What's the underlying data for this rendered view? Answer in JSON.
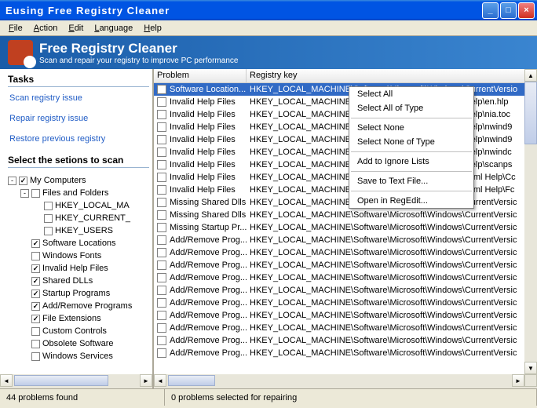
{
  "window": {
    "title": "Eusing Free Registry Cleaner"
  },
  "menu": [
    "File",
    "Action",
    "Edit",
    "Language",
    "Help"
  ],
  "banner": {
    "title": "Free Registry Cleaner",
    "sub": "Scan and repair your registry to improve PC performance"
  },
  "tasks": {
    "header": "Tasks",
    "items": [
      "Scan registry issue",
      "Repair registry issue",
      "Restore previous registry"
    ]
  },
  "sections": {
    "header": "Select the setions to scan",
    "tree": [
      {
        "indent": 0,
        "exp": "-",
        "checked": true,
        "label": "My Computers"
      },
      {
        "indent": 1,
        "exp": "-",
        "checked": false,
        "label": "Files and Folders"
      },
      {
        "indent": 2,
        "exp": "",
        "checked": false,
        "label": "HKEY_LOCAL_MA"
      },
      {
        "indent": 2,
        "exp": "",
        "checked": false,
        "label": "HKEY_CURRENT_"
      },
      {
        "indent": 2,
        "exp": "",
        "checked": false,
        "label": "HKEY_USERS"
      },
      {
        "indent": 1,
        "exp": "",
        "checked": true,
        "label": "Software Locations"
      },
      {
        "indent": 1,
        "exp": "",
        "checked": false,
        "label": "Windows Fonts"
      },
      {
        "indent": 1,
        "exp": "",
        "checked": true,
        "label": "Invalid Help Files"
      },
      {
        "indent": 1,
        "exp": "",
        "checked": true,
        "label": "Shared DLLs"
      },
      {
        "indent": 1,
        "exp": "",
        "checked": true,
        "label": "Startup Programs"
      },
      {
        "indent": 1,
        "exp": "",
        "checked": true,
        "label": "Add/Remove Programs"
      },
      {
        "indent": 1,
        "exp": "",
        "checked": true,
        "label": "File Extensions"
      },
      {
        "indent": 1,
        "exp": "",
        "checked": false,
        "label": "Custom Controls"
      },
      {
        "indent": 1,
        "exp": "",
        "checked": false,
        "label": "Obsolete Software"
      },
      {
        "indent": 1,
        "exp": "",
        "checked": false,
        "label": "Windows Services"
      }
    ]
  },
  "list": {
    "col1": "Problem",
    "col2": "Registry key",
    "rows": [
      {
        "sel": true,
        "problem": "Software Location...",
        "key": "HKEY_LOCAL_MACHINE\\Software\\Microsoft\\Windows\\CurrentVersio"
      },
      {
        "problem": "Invalid Help Files",
        "key": "HKEY_LOCAL_MACHINE\\Software\\Microsoft\\Windows\\Help\\en.hlp"
      },
      {
        "problem": "Invalid Help Files",
        "key": "HKEY_LOCAL_MACHINE\\Software\\Microsoft\\Windows\\Help\\nia.toc"
      },
      {
        "problem": "Invalid Help Files",
        "key": "HKEY_LOCAL_MACHINE\\Software\\Microsoft\\Windows\\Help\\nwind9"
      },
      {
        "problem": "Invalid Help Files",
        "key": "HKEY_LOCAL_MACHINE\\Software\\Microsoft\\Windows\\Help\\nwind9"
      },
      {
        "problem": "Invalid Help Files",
        "key": "HKEY_LOCAL_MACHINE\\Software\\Microsoft\\Windows\\Help\\nwindc"
      },
      {
        "problem": "Invalid Help Files",
        "key": "HKEY_LOCAL_MACHINE\\Software\\Microsoft\\Windows\\Help\\scanps"
      },
      {
        "problem": "Invalid Help Files",
        "key": "HKEY_LOCAL_MACHINE\\Software\\Microsoft\\Windows\\Html Help\\Cc"
      },
      {
        "problem": "Invalid Help Files",
        "key": "HKEY_LOCAL_MACHINE\\Software\\Microsoft\\Windows\\Html Help\\Fc"
      },
      {
        "problem": "Missing Shared Dlls",
        "key": "HKEY_LOCAL_MACHINE\\Software\\Microsoft\\Windows\\CurrentVersic"
      },
      {
        "problem": "Missing Shared Dlls",
        "key": "HKEY_LOCAL_MACHINE\\Software\\Microsoft\\Windows\\CurrentVersic"
      },
      {
        "problem": "Missing Startup Pr...",
        "key": "HKEY_LOCAL_MACHINE\\Software\\Microsoft\\Windows\\CurrentVersic"
      },
      {
        "problem": "Add/Remove Prog...",
        "key": "HKEY_LOCAL_MACHINE\\Software\\Microsoft\\Windows\\CurrentVersic"
      },
      {
        "problem": "Add/Remove Prog...",
        "key": "HKEY_LOCAL_MACHINE\\Software\\Microsoft\\Windows\\CurrentVersic"
      },
      {
        "problem": "Add/Remove Prog...",
        "key": "HKEY_LOCAL_MACHINE\\Software\\Microsoft\\Windows\\CurrentVersic"
      },
      {
        "problem": "Add/Remove Prog...",
        "key": "HKEY_LOCAL_MACHINE\\Software\\Microsoft\\Windows\\CurrentVersic"
      },
      {
        "problem": "Add/Remove Prog...",
        "key": "HKEY_LOCAL_MACHINE\\Software\\Microsoft\\Windows\\CurrentVersic"
      },
      {
        "problem": "Add/Remove Prog...",
        "key": "HKEY_LOCAL_MACHINE\\Software\\Microsoft\\Windows\\CurrentVersic"
      },
      {
        "problem": "Add/Remove Prog...",
        "key": "HKEY_LOCAL_MACHINE\\Software\\Microsoft\\Windows\\CurrentVersic"
      },
      {
        "problem": "Add/Remove Prog...",
        "key": "HKEY_LOCAL_MACHINE\\Software\\Microsoft\\Windows\\CurrentVersic"
      },
      {
        "problem": "Add/Remove Prog...",
        "key": "HKEY_LOCAL_MACHINE\\Software\\Microsoft\\Windows\\CurrentVersic"
      },
      {
        "problem": "Add/Remove Prog...",
        "key": "HKEY_LOCAL_MACHINE\\Software\\Microsoft\\Windows\\CurrentVersic"
      }
    ]
  },
  "context_menu": [
    "Select All",
    "Select All of Type",
    "-",
    "Select None",
    "Select None of Type",
    "-",
    "Add to Ignore Lists",
    "-",
    "Save to Text File...",
    "-",
    "Open in RegEdit..."
  ],
  "status": {
    "left": "44 problems found",
    "right": "0 problems selected for repairing"
  }
}
